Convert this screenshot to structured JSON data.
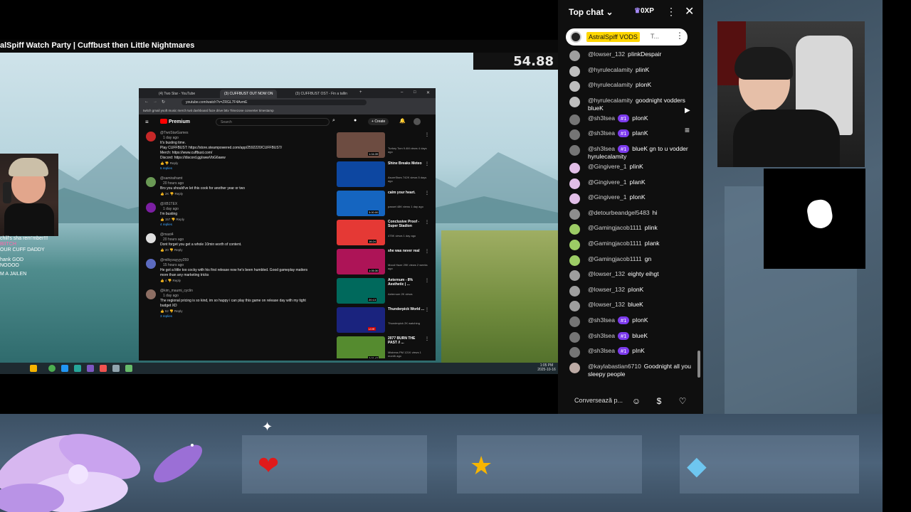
{
  "stream": {
    "title": "alSpiff Watch Party | Cuffbust then Little Nightmares",
    "timer": "54.88",
    "taskbar_clock": "1:05 PM 2025-10-16",
    "side_chat": [
      "chill's sha rem'mber!!!",
      "BIITCH",
      "OUR CUFF DADDY",
      "hank GOD",
      "NOOOO",
      "M A JAILEN"
    ]
  },
  "browser": {
    "tabs": [
      "(4) Two Star - YouTube",
      "(3) CUFFBUST OUT NOW ON",
      "(3) CUFFBUST OST - Fin a tallin"
    ],
    "url": "youtube.com/watch?v=ZRGL7F4AvmE",
    "bookmarks": "twitch  gmail  ysoft  music  merch  twit  dashboard  faze  drive  bttv  Timezone converter  timestamp",
    "yt_logo": "Premium",
    "search_placeholder": "Search",
    "create_label": "Create"
  },
  "comments": [
    {
      "author": "@TwoStarGames",
      "time": "1 day ago",
      "lines": [
        "It's busting time.",
        "Play CUFFBUST: https://store.steampowered.com/app/2592220/CUFFBUST/",
        "Merch: https://www.cuffbust.com/",
        "Discord: https://discord.gg/swwVbG6aww"
      ],
      "likes": "",
      "replies": "6 replies",
      "color": "#c62828"
    },
    {
      "author": "@samiraframt",
      "time": "20 hours ago",
      "lines": [
        "Bro you should've let this cook for another year or two"
      ],
      "likes": "2K",
      "replies": "",
      "color": "#6a9955"
    },
    {
      "author": "@XB1TEX",
      "time": "1 day ago",
      "lines": [
        "I'm busting"
      ],
      "likes": "157",
      "replies": "4 replies",
      "color": "#7b1fa2"
    },
    {
      "author": "@mast4",
      "time": "20 hours ago",
      "lines": [
        "Dont forget you get a whole 10min worth of content."
      ],
      "likes": "20",
      "replies": "",
      "color": "#e0e0e0"
    },
    {
      "author": "@milkyvayyyy259",
      "time": "15 hours ago",
      "lines": [
        "He got a little too cocky with his first release now he's been humbled. Good gameplay matters",
        "more than any marketing tricks"
      ],
      "likes": "4",
      "replies": "",
      "color": "#5c6bc0"
    },
    {
      "author": "@kim_maumi_cyclin",
      "time": "1 day ago",
      "lines": [
        "The regional pricing is so kind, im so happy i can play this game on release day with my tight",
        "budget XD"
      ],
      "likes": "52",
      "replies": "3 replies",
      "color": "#8d6e63"
    }
  ],
  "sidebar_videos": [
    {
      "title": "",
      "meta": "Turkey Tom 9.4M views 4 days ago",
      "time": "1:04:39",
      "color": "#6d4c41"
    },
    {
      "title": "Shine Breaks Meteo",
      "meta": "AsureStars 742K views 5 days ago",
      "time": "",
      "color": "#0d47a1"
    },
    {
      "title": "calm your heart.",
      "meta": "passet 48K views 1 day ago",
      "time": "3:00:00",
      "color": "#1565c0"
    },
    {
      "title": "Conclusive Proof - Super Stadion",
      "meta": "475K views 1 day ago",
      "time": "16:24",
      "color": "#e53935"
    },
    {
      "title": "she was never real",
      "meta": "Mood Haze 29K views 2 weeks ago",
      "time": "1:05:30",
      "color": "#ad1457"
    },
    {
      "title": "Aeternum - 8% Aesthetic | ...",
      "meta": "Aeternum 2K views",
      "time": "20:13",
      "color": "#00695c"
    },
    {
      "title": "Thunderpick World ...",
      "meta": "Thunderpick 2K watching",
      "time": "LIVE",
      "color": "#1a237e"
    },
    {
      "title": "2077 BURN THE PAST // ...",
      "meta": "Mistress PM 121K views 1 month ago",
      "time": "2:01:47",
      "color": "#558b2f"
    }
  ],
  "chat": {
    "title": "Top chat",
    "xp": "0XP",
    "pinned_name": "AstralSpiff VODS",
    "pinned_text": "T...",
    "input_placeholder": "Conversează p...",
    "messages": [
      {
        "user": "@lowser_132",
        "badge": "",
        "text": "pIinkDespair",
        "color": "#9e9e9e"
      },
      {
        "user": "@hyrulecalamity",
        "badge": "",
        "text": "pIinK",
        "color": "#bdbdbd"
      },
      {
        "user": "@hyrulecalamity",
        "badge": "",
        "text": "pIonK",
        "color": "#bdbdbd"
      },
      {
        "user": "@hyrulecalamity",
        "badge": "",
        "text": "goodnight vodders blueK",
        "color": "#bdbdbd"
      },
      {
        "user": "@sh3lsea",
        "badge": "#1",
        "text": "pIonK",
        "color": "#757575"
      },
      {
        "user": "@sh3lsea",
        "badge": "#1",
        "text": "pIanK",
        "color": "#757575"
      },
      {
        "user": "@sh3lsea",
        "badge": "#1",
        "text": "blueK gn to u vodder hyrulecalamity",
        "color": "#757575"
      },
      {
        "user": "@Gingivere_1",
        "badge": "",
        "text": "pIinK",
        "color": "#e1bee7"
      },
      {
        "user": "@Gingivere_1",
        "badge": "",
        "text": "pIanK",
        "color": "#e1bee7"
      },
      {
        "user": "@Gingivere_1",
        "badge": "",
        "text": "pIonK",
        "color": "#e1bee7"
      },
      {
        "user": "@detourbeandgel5483",
        "badge": "",
        "text": "hi",
        "color": "#8d8d8d"
      },
      {
        "user": "@Gamingjacob1111",
        "badge": "",
        "text": "pIink",
        "color": "#9ccc65"
      },
      {
        "user": "@Gamingjacob1111",
        "badge": "",
        "text": "pIank",
        "color": "#9ccc65"
      },
      {
        "user": "@Gamingjacob1111",
        "badge": "",
        "text": "gn",
        "color": "#9ccc65"
      },
      {
        "user": "@lowser_132",
        "badge": "",
        "text": "eighty eihgt",
        "color": "#9e9e9e"
      },
      {
        "user": "@lowser_132",
        "badge": "",
        "text": "pIonK",
        "color": "#9e9e9e"
      },
      {
        "user": "@lowser_132",
        "badge": "",
        "text": "blueK",
        "color": "#9e9e9e"
      },
      {
        "user": "@sh3lsea",
        "badge": "#1",
        "text": "pIonK",
        "color": "#757575"
      },
      {
        "user": "@sh3lsea",
        "badge": "#1",
        "text": "blueK",
        "color": "#757575"
      },
      {
        "user": "@sh3lsea",
        "badge": "#1",
        "text": "pInK",
        "color": "#757575"
      },
      {
        "user": "@kaylabastian6710",
        "badge": "",
        "text": "Goodnight all you sleepy people",
        "color": "#bcaaa4"
      }
    ]
  },
  "overlay": {
    "goal_icons": [
      "heart-icon",
      "star-icon",
      "diamond-icon"
    ],
    "accent": "#7c3aed"
  }
}
